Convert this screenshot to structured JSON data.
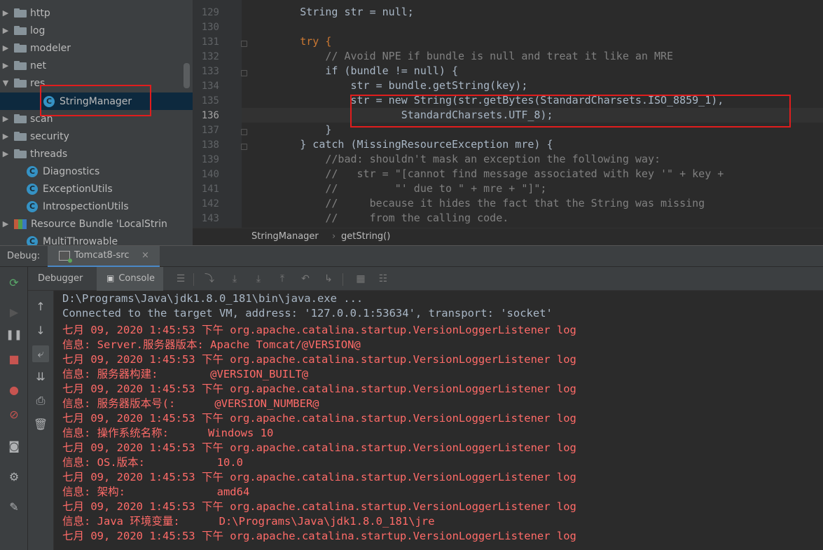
{
  "project_tree": {
    "items": [
      {
        "label": "http",
        "type": "folder",
        "expand": "collapsed"
      },
      {
        "label": "log",
        "type": "folder",
        "expand": "collapsed"
      },
      {
        "label": "modeler",
        "type": "folder",
        "expand": "collapsed"
      },
      {
        "label": "net",
        "type": "folder",
        "expand": "collapsed"
      },
      {
        "label": "res",
        "type": "folder",
        "expand": "expanded"
      },
      {
        "label": "StringManager",
        "type": "class",
        "selected": true
      },
      {
        "label": "scan",
        "type": "folder",
        "expand": "collapsed"
      },
      {
        "label": "security",
        "type": "folder",
        "expand": "collapsed"
      },
      {
        "label": "threads",
        "type": "folder",
        "expand": "collapsed"
      },
      {
        "label": "Diagnostics",
        "type": "class"
      },
      {
        "label": "ExceptionUtils",
        "type": "class"
      },
      {
        "label": "IntrospectionUtils",
        "type": "class"
      },
      {
        "label": "Resource Bundle 'LocalStrin",
        "type": "resource",
        "expand": "collapsed"
      },
      {
        "label": "MultiThrowable",
        "type": "class"
      }
    ]
  },
  "editor": {
    "line_numbers": [
      "129",
      "130",
      "131",
      "132",
      "133",
      "134",
      "135",
      "136",
      "137",
      "138",
      "139",
      "140",
      "141",
      "142",
      "143"
    ],
    "lines": [
      "        String str = null;",
      "",
      "        try {",
      "            // Avoid NPE if bundle is null and treat it like an MRE",
      "            if (bundle != null) {",
      "                str = bundle.getString(key);",
      "                str = new String(str.getBytes(StandardCharsets.ISO_8859_1),",
      "                        StandardCharsets.UTF_8);",
      "            }",
      "        } catch (MissingResourceException mre) {",
      "            //bad: shouldn't mask an exception the following way:",
      "            //   str = \"[cannot find message associated with key '\" + key +",
      "            //         \"' due to \" + mre + \"]\";",
      "            //     because it hides the fact that the String was missing",
      "            //     from the calling code."
    ],
    "breadcrumb": [
      "StringManager",
      "getString()"
    ]
  },
  "debug": {
    "label": "Debug:",
    "session_tab": "Tomcat8-src",
    "tabs": [
      "Debugger",
      "Console"
    ],
    "active_tab": "Console"
  },
  "console": {
    "lines": [
      {
        "text": "D:\\Programs\\Java\\jdk1.8.0_181\\bin\\java.exe ...",
        "color": "gray"
      },
      {
        "text": "Connected to the target VM, address: '127.0.0.1:53634', transport: 'socket'",
        "color": "gray"
      },
      {
        "text": "七月 09, 2020 1:45:53 下午 org.apache.catalina.startup.VersionLoggerListener log",
        "color": "red"
      },
      {
        "text": "信息: Server.服务器版本: Apache Tomcat/@VERSION@",
        "color": "red"
      },
      {
        "text": "七月 09, 2020 1:45:53 下午 org.apache.catalina.startup.VersionLoggerListener log",
        "color": "red"
      },
      {
        "text": "信息: 服务器构建:        @VERSION_BUILT@",
        "color": "red"
      },
      {
        "text": "七月 09, 2020 1:45:53 下午 org.apache.catalina.startup.VersionLoggerListener log",
        "color": "red"
      },
      {
        "text": "信息: 服务器版本号(:      @VERSION_NUMBER@",
        "color": "red"
      },
      {
        "text": "七月 09, 2020 1:45:53 下午 org.apache.catalina.startup.VersionLoggerListener log",
        "color": "red"
      },
      {
        "text": "信息: 操作系统名称:      Windows 10",
        "color": "red"
      },
      {
        "text": "七月 09, 2020 1:45:53 下午 org.apache.catalina.startup.VersionLoggerListener log",
        "color": "red"
      },
      {
        "text": "信息: OS.版本:           10.0",
        "color": "red"
      },
      {
        "text": "七月 09, 2020 1:45:53 下午 org.apache.catalina.startup.VersionLoggerListener log",
        "color": "red"
      },
      {
        "text": "信息: 架构:              amd64",
        "color": "red"
      },
      {
        "text": "七月 09, 2020 1:45:53 下午 org.apache.catalina.startup.VersionLoggerListener log",
        "color": "red"
      },
      {
        "text": "信息: Java 环境变量:      D:\\Programs\\Java\\jdk1.8.0_181\\jre",
        "color": "red"
      },
      {
        "text": "七月 09, 2020 1:45:53 下午 org.apache.catalina.startup.VersionLoggerListener log",
        "color": "red"
      }
    ]
  },
  "colors": {
    "accent_red_box": "#e11d1d",
    "console_error": "#ff6b68",
    "keyword": "#cc7832",
    "selection": "#0d293e"
  }
}
